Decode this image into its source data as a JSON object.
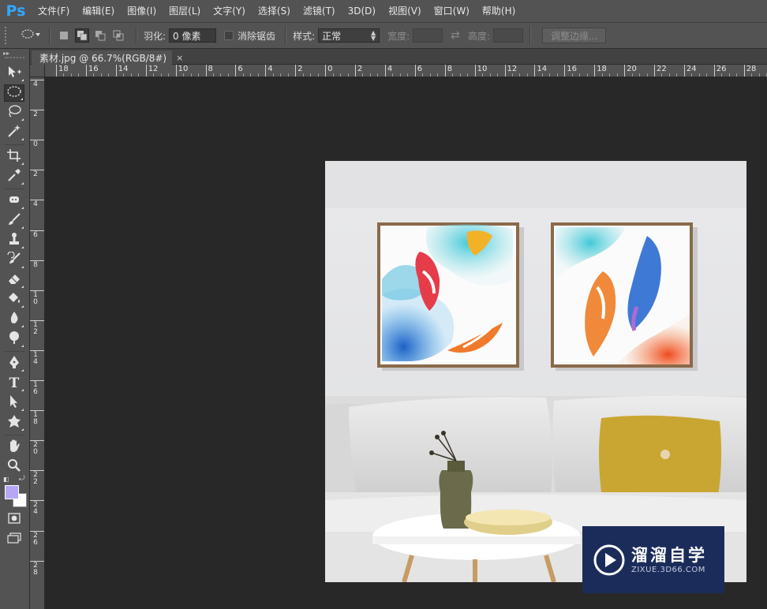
{
  "app": {
    "logo": "Ps"
  },
  "menu": [
    "文件(F)",
    "编辑(E)",
    "图像(I)",
    "图层(L)",
    "文字(Y)",
    "选择(S)",
    "滤镜(T)",
    "3D(D)",
    "视图(V)",
    "窗口(W)",
    "帮助(H)"
  ],
  "options": {
    "tool_icon": "elliptical-marquee-icon",
    "feather_label": "羽化:",
    "feather_value": "0 像素",
    "antialias_label": "消除锯齿",
    "style_label": "样式:",
    "style_value": "正常",
    "width_label": "宽度:",
    "height_label": "高度:",
    "refine_edge": "调整边缘..."
  },
  "document_tab": {
    "title": "素材.jpg @ 66.7%(RGB/8#)",
    "close": "×"
  },
  "ruler_h": [
    "18",
    "16",
    "14",
    "12",
    "10",
    "8",
    "6",
    "4",
    "2",
    "0",
    "2",
    "4",
    "6",
    "8",
    "10",
    "12",
    "14",
    "16",
    "18",
    "20",
    "22",
    "24",
    "26",
    "28"
  ],
  "ruler_v": [
    "4",
    "2",
    "0",
    "2",
    "4",
    "6",
    "8",
    "10",
    "12",
    "14",
    "16",
    "18",
    "20",
    "22",
    "24",
    "26",
    "28"
  ],
  "colors": {
    "foreground": "#b7a6f5",
    "background": "#ffffff"
  },
  "tools": [
    "move-tool-icon",
    "elliptical-marquee-icon",
    "lasso-icon",
    "magic-wand-icon",
    "crop-icon",
    "eyedropper-icon",
    "healing-brush-icon",
    "brush-icon",
    "clone-stamp-icon",
    "history-brush-icon",
    "eraser-icon",
    "paint-bucket-icon",
    "blur-icon",
    "dodge-icon",
    "pen-icon",
    "type-icon",
    "path-selection-icon",
    "custom-shape-icon",
    "hand-icon",
    "zoom-icon"
  ],
  "watermark": {
    "title": "溜溜自学",
    "subtitle": "ZIXUE.3D66.COM"
  }
}
